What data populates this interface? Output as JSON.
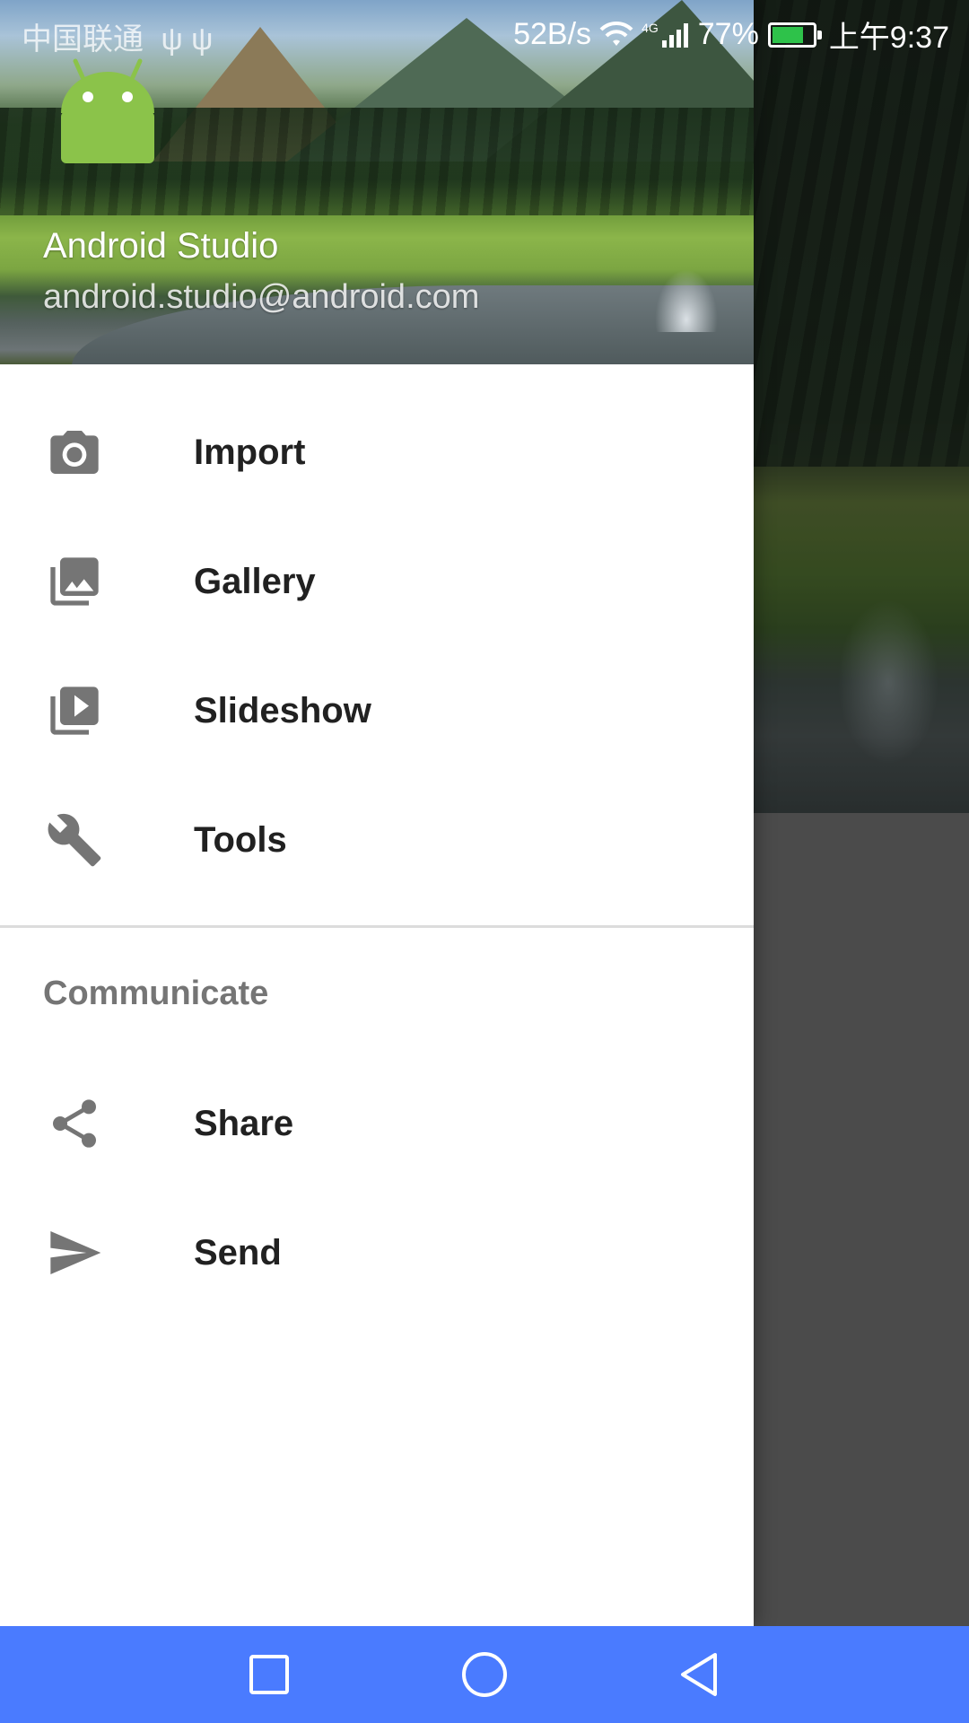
{
  "status_bar": {
    "carrier": "中国联通",
    "usb_icons": "ψ ψ",
    "net_speed": "52B/s",
    "network_type": "4G",
    "battery_percent": "77%",
    "battery_level": 0.77,
    "time": "上午9:37"
  },
  "drawer": {
    "header": {
      "name": "Android Studio",
      "email": "android.studio@android.com"
    },
    "primary_items": [
      {
        "label": "Import",
        "icon": "camera-icon"
      },
      {
        "label": "Gallery",
        "icon": "gallery-icon"
      },
      {
        "label": "Slideshow",
        "icon": "slideshow-icon"
      },
      {
        "label": "Tools",
        "icon": "wrench-icon"
      }
    ],
    "section_header": "Communicate",
    "secondary_items": [
      {
        "label": "Share",
        "icon": "share-icon"
      },
      {
        "label": "Send",
        "icon": "send-icon"
      }
    ]
  },
  "nav_bar": {
    "buttons": [
      "recents-button",
      "home-button",
      "back-button"
    ]
  },
  "colors": {
    "nav_bar": "#4a7bff",
    "android_green": "#8bc34a",
    "menu_text": "#212121",
    "icon_grey": "#757575",
    "section_text": "#757575",
    "battery_green": "#2ec24a"
  }
}
